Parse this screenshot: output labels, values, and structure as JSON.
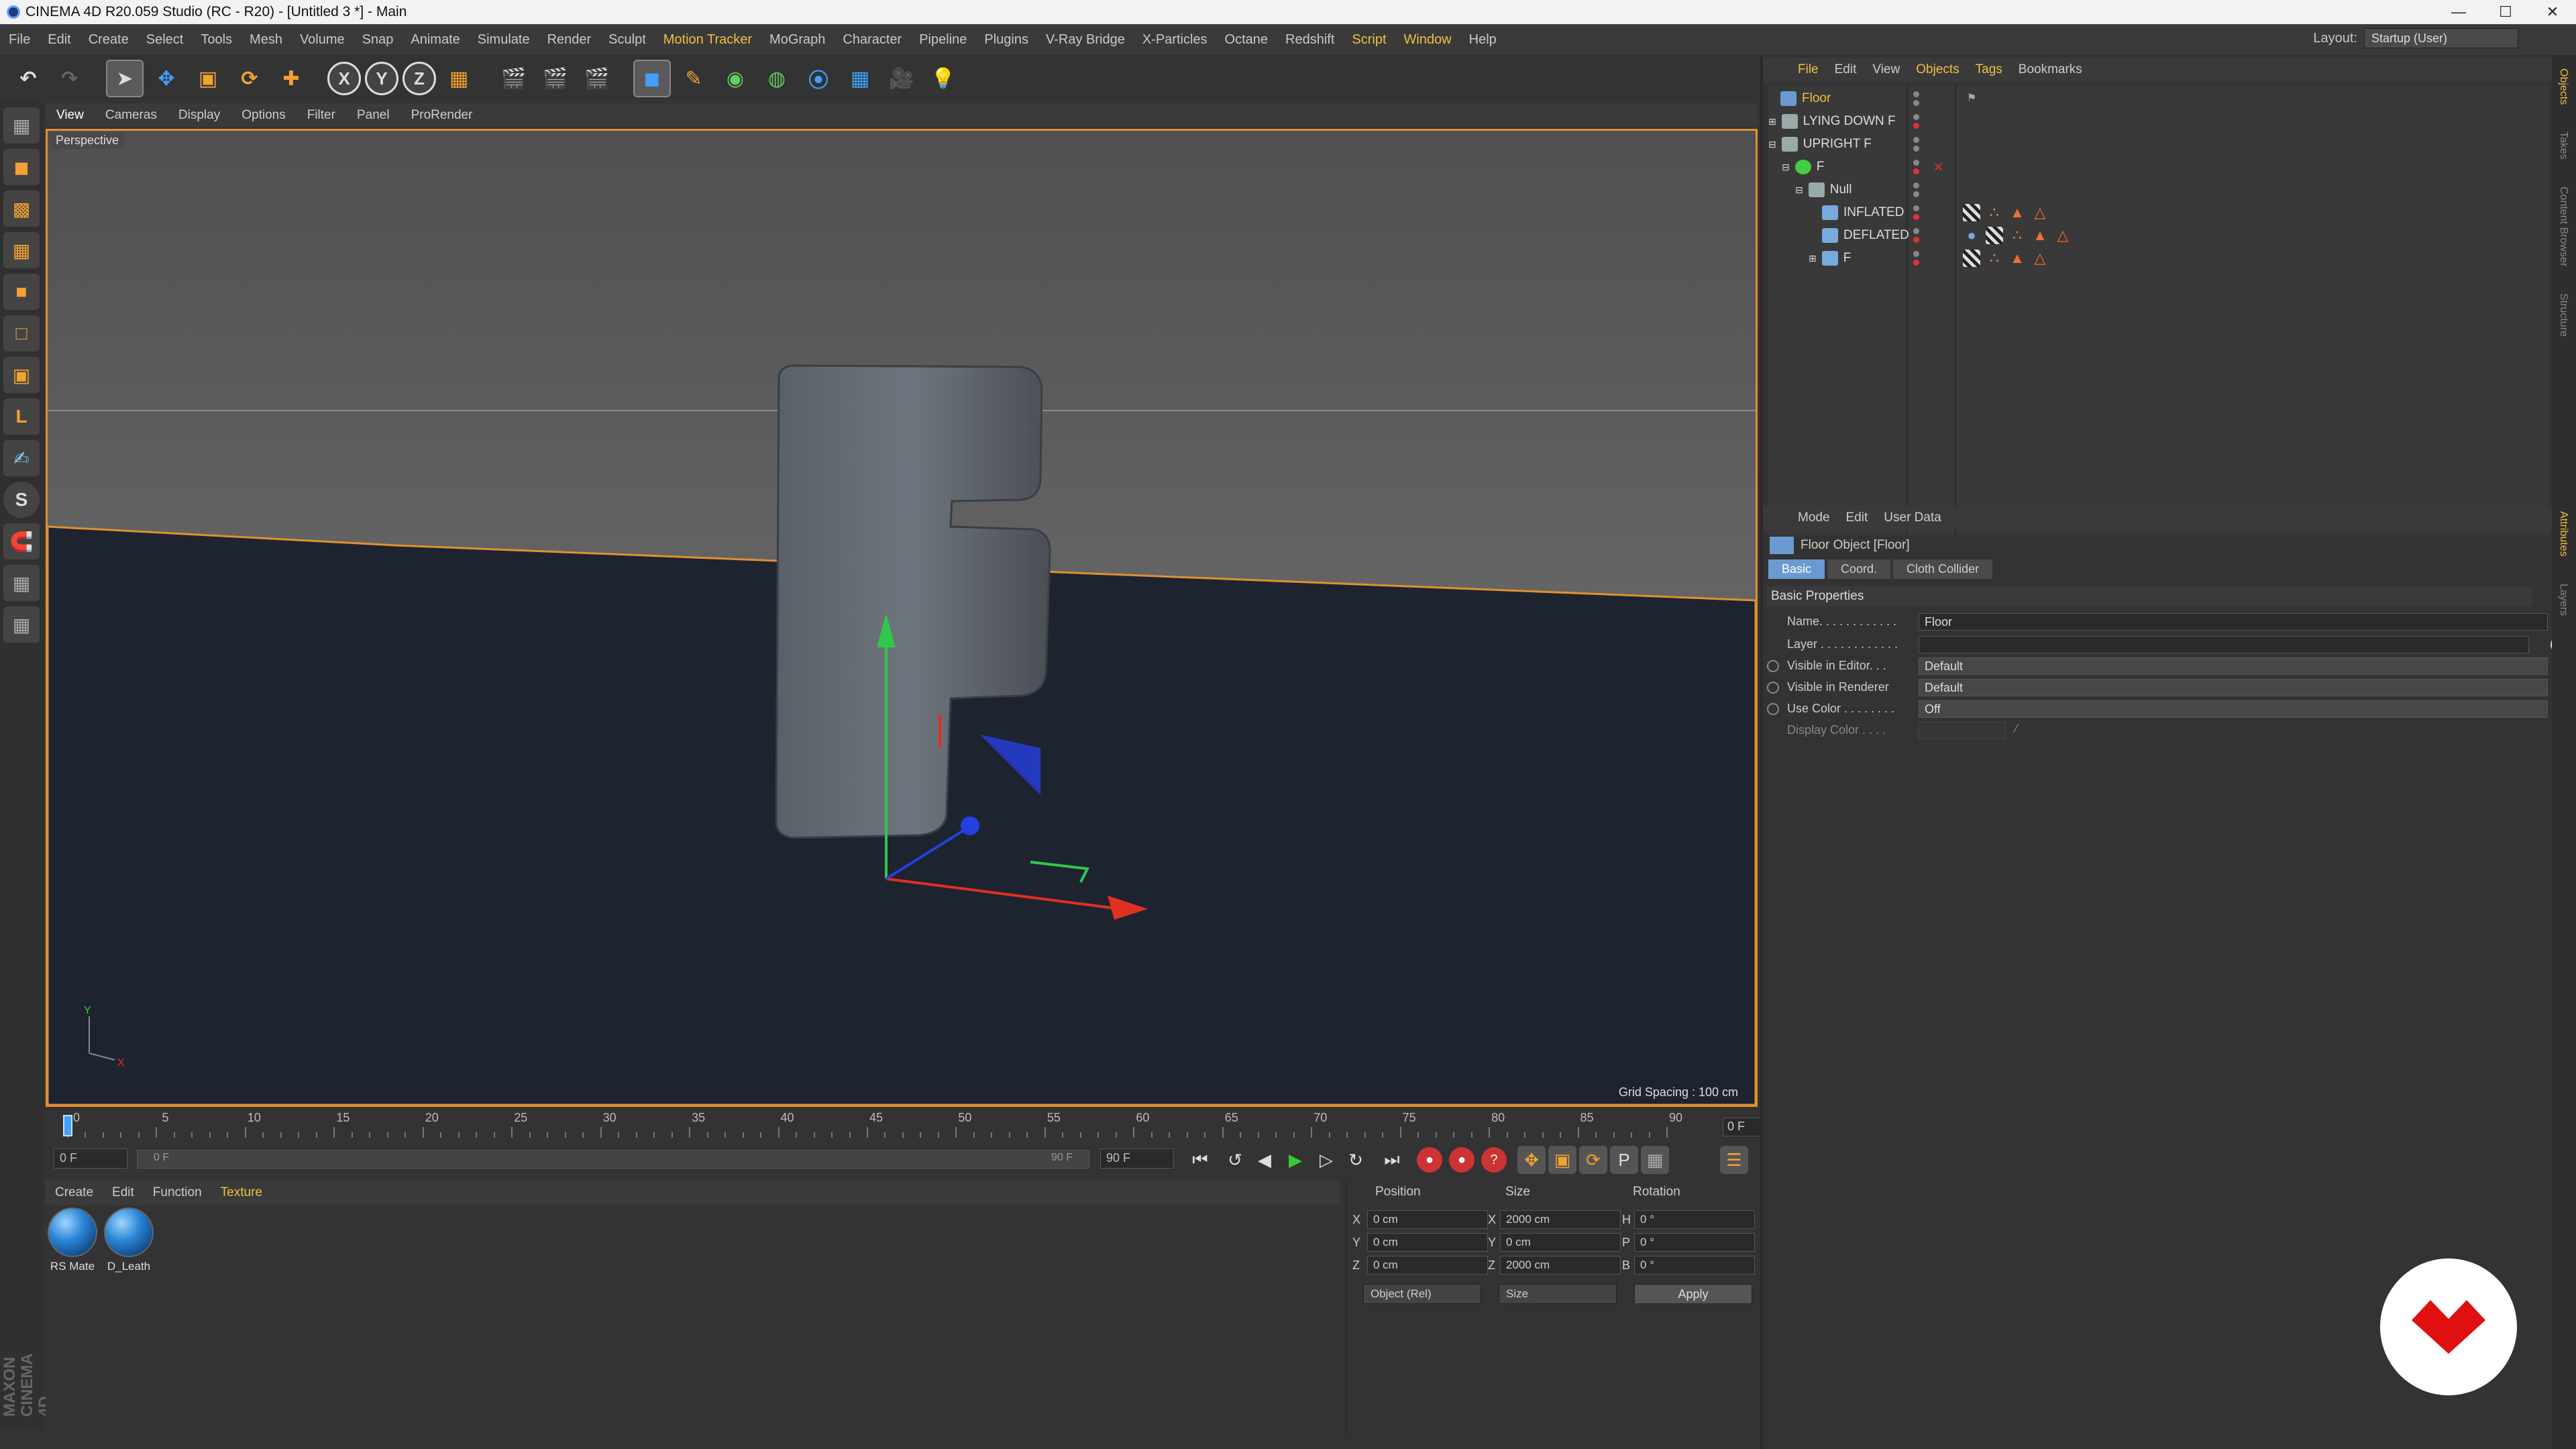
{
  "window": {
    "title": "CINEMA 4D R20.059 Studio (RC - R20) - [Untitled 3 *] - Main",
    "minimize_icon": "minimize-icon",
    "maximize_icon": "maximize-icon",
    "close_icon": "close-icon"
  },
  "menubar": {
    "items": [
      "File",
      "Edit",
      "Create",
      "Select",
      "Tools",
      "Mesh",
      "Volume",
      "Snap",
      "Animate",
      "Simulate",
      "Render",
      "Sculpt",
      "Motion Tracker",
      "MoGraph",
      "Character",
      "Pipeline",
      "Plugins",
      "V-Ray Bridge",
      "X-Particles",
      "Octane",
      "Redshift",
      "Script",
      "Window",
      "Help"
    ],
    "layout_label": "Layout:",
    "layout_value": "Startup (User)"
  },
  "viewport": {
    "menu": [
      "View",
      "Cameras",
      "Display",
      "Options",
      "Filter",
      "Panel",
      "ProRender"
    ],
    "camera_label": "Perspective",
    "grid_spacing": "Grid Spacing : 100 cm",
    "axis_y": "Y",
    "axis_x": "X"
  },
  "timeline": {
    "ticks": [
      "0",
      "5",
      "10",
      "15",
      "20",
      "25",
      "30",
      "35",
      "40",
      "45",
      "50",
      "55",
      "60",
      "65",
      "70",
      "75",
      "80",
      "85",
      "90"
    ],
    "current_frame": "0 F"
  },
  "playback": {
    "start_frame": "0 F",
    "range_start": "0 F",
    "range_end": "90 F",
    "end_frame": "90 F"
  },
  "material_manager": {
    "menu": [
      "Create",
      "Edit",
      "Function",
      "Texture"
    ],
    "materials": [
      {
        "name": "RS Mate"
      },
      {
        "name": "D_Leath"
      }
    ]
  },
  "coordinates": {
    "headers": {
      "position": "Position",
      "size": "Size",
      "rotation": "Rotation"
    },
    "rows": [
      {
        "axis": "X",
        "pos": "0 cm",
        "size_axis": "X",
        "size": "2000 cm",
        "rot_axis": "H",
        "rot": "0 °"
      },
      {
        "axis": "Y",
        "pos": "0 cm",
        "size_axis": "Y",
        "size": "0 cm",
        "rot_axis": "P",
        "rot": "0 °"
      },
      {
        "axis": "Z",
        "pos": "0 cm",
        "size_axis": "Z",
        "size": "2000 cm",
        "rot_axis": "B",
        "rot": "0 °"
      }
    ],
    "mode": "Object (Rel)",
    "size_mode": "Size",
    "apply": "Apply"
  },
  "object_manager": {
    "menu": [
      "File",
      "Edit",
      "View",
      "Objects",
      "Tags",
      "Bookmarks"
    ],
    "objects": [
      {
        "name": "Floor",
        "selected": true
      },
      {
        "name": "LYING DOWN F"
      },
      {
        "name": "UPRIGHT F"
      },
      {
        "name": "F"
      },
      {
        "name": "Null"
      },
      {
        "name": "INFLATED"
      },
      {
        "name": "DEFLATED"
      },
      {
        "name": "F"
      }
    ]
  },
  "attribute_manager": {
    "menu": [
      "Mode",
      "Edit",
      "User Data"
    ],
    "title": "Floor Object [Floor]",
    "tabs": [
      "Basic",
      "Coord.",
      "Cloth Collider"
    ],
    "section": "Basic Properties",
    "fields": {
      "name_label": "Name. . . . . . . . . . . .",
      "name_value": "Floor",
      "layer_label": "Layer . . . . . . . . . . . .",
      "vis_editor_label": "Visible in Editor. . .",
      "vis_editor_value": "Default",
      "vis_renderer_label": "Visible in Renderer",
      "vis_renderer_value": "Default",
      "use_color_label": "Use Color . . . . . . . .",
      "use_color_value": "Off",
      "display_color_label": "Display Color . . . ."
    }
  },
  "side_tabs": [
    "Objects",
    "Takes",
    "Content Browser",
    "Structure",
    "Attributes",
    "Layers"
  ],
  "brand": "MAXON CINEMA 4D",
  "colors": {
    "accent": "#f0c040",
    "viewport_border": "#e09030",
    "floor": "#1e2330",
    "sky": "#6f6f6f",
    "active_tab": "#6a9ad0"
  }
}
